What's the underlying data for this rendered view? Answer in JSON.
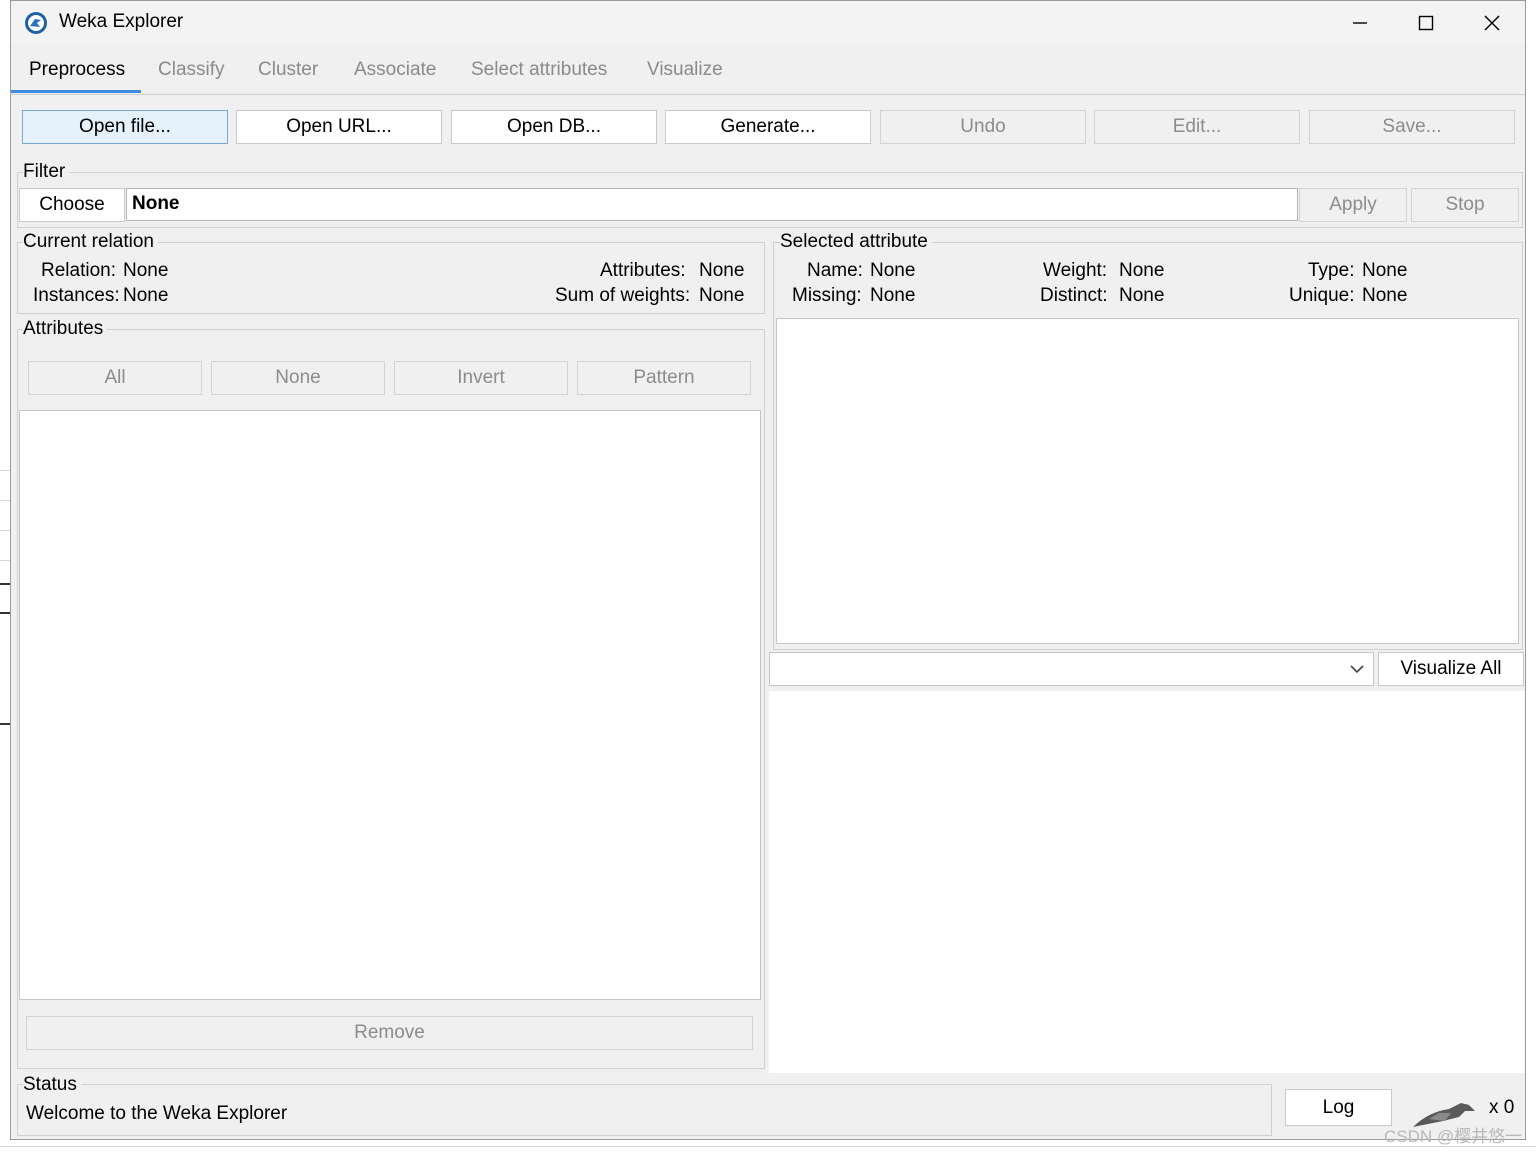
{
  "window": {
    "title": "Weka Explorer"
  },
  "tabs": [
    {
      "label": "Preprocess"
    },
    {
      "label": "Classify"
    },
    {
      "label": "Cluster"
    },
    {
      "label": "Associate"
    },
    {
      "label": "Select attributes"
    },
    {
      "label": "Visualize"
    }
  ],
  "toolbar": {
    "open_file": "Open file...",
    "open_url": "Open URL...",
    "open_db": "Open DB...",
    "generate": "Generate...",
    "undo": "Undo",
    "edit": "Edit...",
    "save": "Save..."
  },
  "filter": {
    "title": "Filter",
    "choose": "Choose",
    "value": "None",
    "apply": "Apply",
    "stop": "Stop"
  },
  "current_relation": {
    "title": "Current relation",
    "relation_label": "Relation:",
    "relation_value": "None",
    "instances_label": "Instances:",
    "instances_value": "None",
    "attributes_label": "Attributes:",
    "attributes_value": "None",
    "sum_weights_label": "Sum of weights:",
    "sum_weights_value": "None"
  },
  "attributes": {
    "title": "Attributes",
    "all": "All",
    "none": "None",
    "invert": "Invert",
    "pattern": "Pattern",
    "remove": "Remove"
  },
  "selected_attribute": {
    "title": "Selected attribute",
    "name_label": "Name:",
    "name_value": "None",
    "missing_label": "Missing:",
    "missing_value": "None",
    "weight_label": "Weight:",
    "weight_value": "None",
    "distinct_label": "Distinct:",
    "distinct_value": "None",
    "type_label": "Type:",
    "type_value": "None",
    "unique_label": "Unique:",
    "unique_value": "None"
  },
  "visualize": {
    "class_select": "",
    "visualize_all": "Visualize All"
  },
  "status": {
    "title": "Status",
    "message": "Welcome to the Weka Explorer",
    "log": "Log",
    "tasks": "x 0"
  },
  "watermark": "CSDN @樱井悠一",
  "colors": {
    "accent": "#3c8dde",
    "primary_button_bg": "#e5f1fb",
    "panel_bg": "#f0f0f0"
  }
}
